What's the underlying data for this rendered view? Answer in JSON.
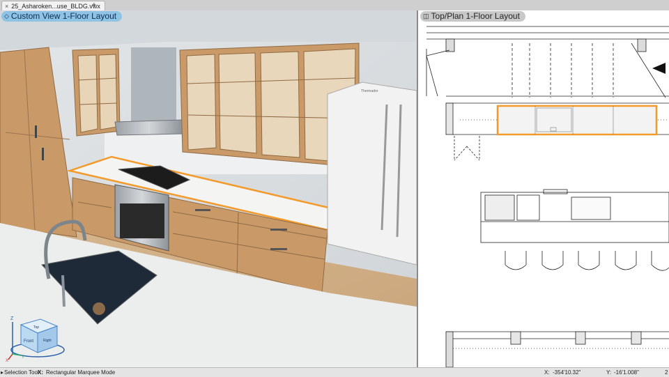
{
  "document_tab": {
    "close_label": "×",
    "title": "25_Asharoken...use_BLDG.vwx",
    "add_label": "+"
  },
  "left_view": {
    "icon": "◇",
    "label": "Custom View  1-Floor Layout"
  },
  "right_view": {
    "icon": "◫",
    "label": "Top/Plan  1-Floor Layout"
  },
  "appliance_brand": "Thermador",
  "view_cube": {
    "top_face": "Top",
    "front_face": "Front",
    "right_face": "Right",
    "axis_z": "Z",
    "axis_x": "X",
    "axis_y": "Y"
  },
  "status_bar": {
    "tool": "Selection Tool",
    "mode_key": "X:",
    "mode": "Rectangular Marquee Mode",
    "x_label": "X:",
    "x_value": "-354'10.32\"",
    "y_label": "Y:",
    "y_value": "-16'1.008\"",
    "trailing": "2"
  },
  "colors": {
    "selection_highlight": "#f39a2a",
    "active_view_label": "#8fc3e6",
    "wood": "#c99a68"
  }
}
